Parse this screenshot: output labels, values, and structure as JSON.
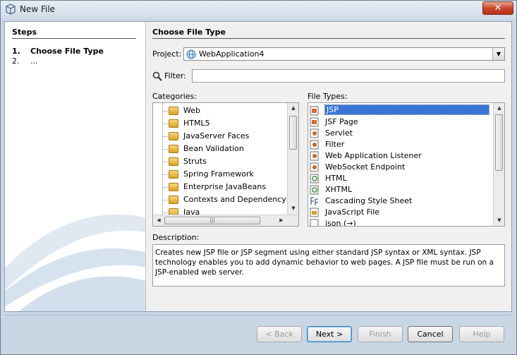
{
  "window": {
    "title": "New File"
  },
  "steps": {
    "title": "Steps",
    "items": [
      {
        "num": "1.",
        "label": "Choose File Type"
      },
      {
        "num": "2.",
        "label": "..."
      }
    ]
  },
  "main": {
    "title": "Choose File Type",
    "project_label": "Project:",
    "project_value": "WebApplication4",
    "filter_label": "Filter:",
    "filter_value": "",
    "categories_label": "Categories:",
    "file_types_label": "File Types:",
    "categories": [
      "Web",
      "HTML5",
      "JavaServer Faces",
      "Bean Validation",
      "Struts",
      "Spring Framework",
      "Enterprise JavaBeans",
      "Contexts and Dependency Inj",
      "Java"
    ],
    "file_types": [
      "JSP",
      "JSF Page",
      "Servlet",
      "Filter",
      "Web Application Listener",
      "WebSocket Endpoint",
      "HTML",
      "XHTML",
      "Cascading Style Sheet",
      "JavaScript File",
      "json (→)"
    ],
    "selected_category": "Web",
    "selected_file_type": "JSP",
    "description_label": "Description:",
    "description_text": "Creates new JSP file or JSP segment using either standard JSP syntax or XML syntax. JSP technology enables you to add dynamic behavior to web pages. A JSP file must be run on a JSP-enabled web server."
  },
  "buttons": {
    "back": "< Back",
    "next": "Next >",
    "finish": "Finish",
    "cancel": "Cancel",
    "help": "Help"
  },
  "colors": {
    "selection": "#3875d7",
    "folder": "#e8b83a"
  }
}
